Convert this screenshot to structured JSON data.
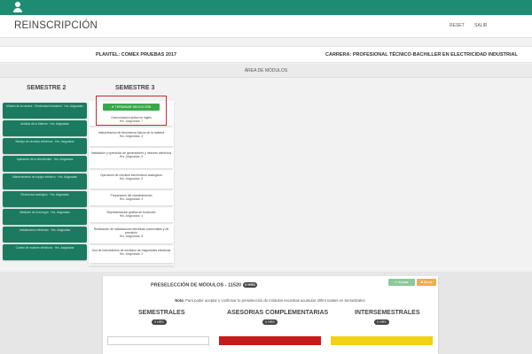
{
  "header": {
    "title": "REINSCRIPCIÓN",
    "nav": {
      "reset": "RESET",
      "salir": "SALIR"
    }
  },
  "info": {
    "plantel": "PLANTEL: COMEX PRUEBAS 2017",
    "carrera": "CARRERA: PROFESIONAL TÉCNICO-BACHILLER EN ELECTRICIDAD INDUSTRIAL"
  },
  "area": {
    "label": "ÁREA DE MÓDULOS"
  },
  "semestre2": {
    "title": "SEMESTRE 2",
    "cards": [
      "Módulo de la carrera · Electricidad Industrial · Hrs. Asignadas",
      "Análisis de la Materia · Hrs. Asignadas",
      "Manejo de circuitos eléctricos · Hrs. Asignadas",
      "Aplicación de la electricidad · Hrs. Asignadas",
      "Mantenimiento de equipo eléctrico · Hrs. Asignadas",
      "Electrónica analógica · Hrs. Asignadas",
      "Medición de la energía · Hrs. Asignadas",
      "Instalaciones eléctricas · Hrs. Asignadas",
      "Control de motores eléctricos · Hrs. Asignadas"
    ]
  },
  "semestre3": {
    "title": "SEMESTRE 3",
    "select_button": "TERMINAR SELECCIÓN",
    "cards": [
      {
        "name": "Comunicación activa en inglés",
        "hrs": "Hrs. Asignadas: 7"
      },
      {
        "name": "Interpretación de fenómenos físicos de la materia",
        "hrs": "Hrs. Asignadas: 4"
      },
      {
        "name": "Instalación y operación de generadores y motores eléctricos",
        "hrs": "Hrs. Asignadas: 9"
      },
      {
        "name": "Operación de circuitos electrónicos analógicos",
        "hrs": "Hrs. Asignadas: 5"
      },
      {
        "name": "Preparación del mantenimiento",
        "hrs": "Hrs. Asignadas: 4"
      },
      {
        "name": "Representación gráfica de funciones",
        "hrs": "Hrs. Asignadas: 4"
      },
      {
        "name": "Realización de instalaciones eléctricas comerciales y de previsión",
        "hrs": "Hrs. Asignadas: 8"
      },
      {
        "name": "Uso de instrumentos de medición de magnitudes eléctricas",
        "hrs": "Hrs. Asignadas: 2"
      }
    ]
  },
  "preseleccion": {
    "title": "PRESELECCIÓN DE MÓDULOS - 11520",
    "title_badge": "0 HRS",
    "btn_green": "✔ Aceptar",
    "btn_orange": "✖ Borrar",
    "note_bold": "Nota:",
    "note_text": " Para poder aceptar y confirmar tu preselección de módulos necesitas acumular 30hrs totales en Semestrales.",
    "groups": [
      {
        "title": "SEMESTRALES",
        "hrs": "0 HRS"
      },
      {
        "title": "ASESORIAS COMPLEMENTARIAS",
        "hrs": "0 HRS"
      },
      {
        "title": "INTERSEMESTRALES",
        "hrs": "0 HRS"
      }
    ]
  },
  "colors": {
    "topbar": "#1e8c72",
    "sem2_card": "#1b7a60",
    "select_button": "#3aa84a",
    "highlight": "#cc2b2b",
    "asesorias": "#c41b1b",
    "intersemestrales": "#f1d21a"
  },
  "icons": {
    "user": "user-icon"
  }
}
